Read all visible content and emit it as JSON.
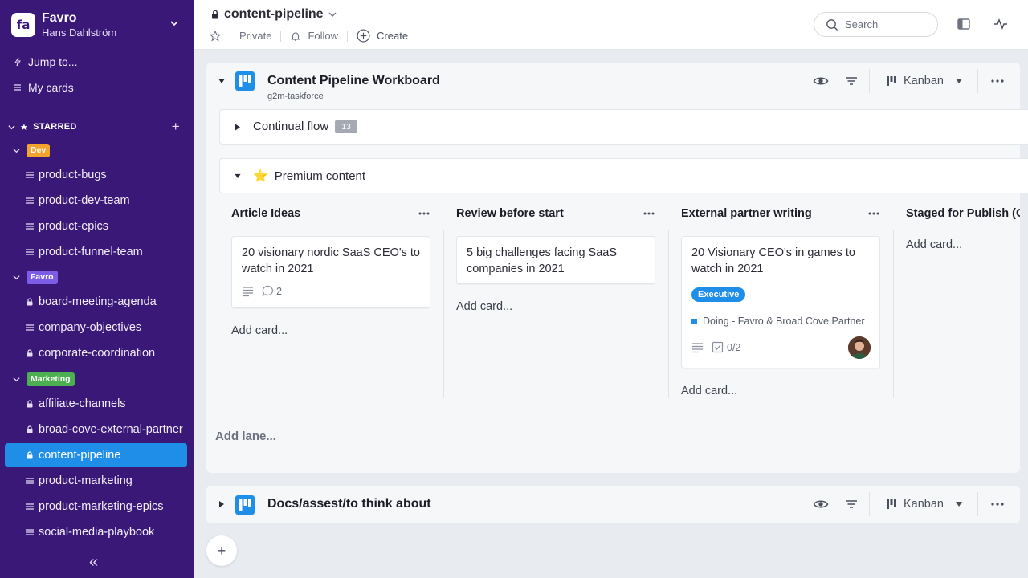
{
  "sidebar": {
    "org_logo": "fa",
    "org_name": "Favro",
    "user_name": "Hans Dahlström",
    "jump_to": "Jump to...",
    "my_cards": "My cards",
    "starred_label": "STARRED",
    "add_label": "+",
    "folders": [
      {
        "tag": "Dev",
        "color": "#f4a42c",
        "boards": [
          "product-bugs",
          "product-dev-team",
          "product-epics",
          "product-funnel-team"
        ]
      },
      {
        "tag": "Favro",
        "color": "#7d5ce6",
        "boards": [
          "board-meeting-agenda",
          "company-objectives",
          "corporate-coordination"
        ]
      },
      {
        "tag": "Marketing",
        "color": "#4caf50",
        "boards": [
          "affiliate-channels",
          "broad-cove-external-partner",
          "content-pipeline",
          "product-marketing",
          "product-marketing-epics",
          "social-media-playbook"
        ]
      }
    ],
    "collapse_label": "«"
  },
  "topbar": {
    "title": "content-pipeline",
    "private_label": "Private",
    "follow_label": "Follow",
    "create_label": "Create",
    "search_placeholder": "Search"
  },
  "widget1": {
    "title": "Content Pipeline Workboard",
    "subtitle": "g2m-taskforce",
    "view_label": "Kanban",
    "rows": [
      {
        "label": "Continual flow",
        "count": "13"
      },
      {
        "label": "Premium content",
        "icon": "⭐"
      }
    ],
    "columns": [
      {
        "title": "Article Ideas",
        "card": {
          "title": "20 visionary nordic SaaS CEO's to watch in 2021",
          "comments": "2"
        },
        "add_card": "Add card..."
      },
      {
        "title": "Review before start",
        "card": {
          "title": "5 big challenges facing SaaS companies in 2021"
        },
        "add_card": "Add card..."
      },
      {
        "title": "External partner writing",
        "card": {
          "title": "20 Visionary CEO's in games to watch in 2021",
          "tag": "Executive",
          "status": "Doing - Favro & Broad Cove Partner",
          "checklist": "0/2"
        },
        "add_card": "Add card..."
      },
      {
        "title": "Staged for Publish (C",
        "add_card": "Add card..."
      }
    ],
    "add_lane": "Add lane..."
  },
  "widget2": {
    "title": "Docs/assest/to think about",
    "view_label": "Kanban"
  },
  "fab_label": "+",
  "colors": {
    "sidebar_bg": "#3a1878",
    "accent": "#1f8ee8"
  }
}
